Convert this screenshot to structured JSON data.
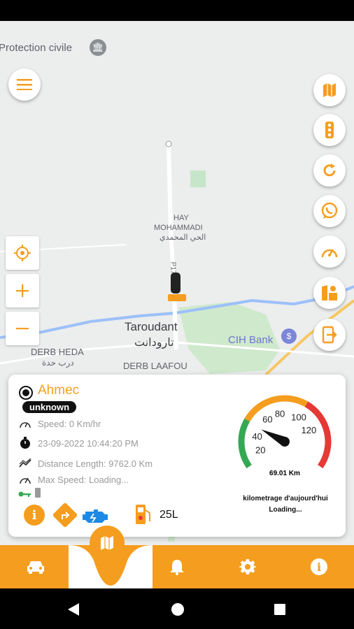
{
  "map": {
    "poi_protection": "Protection civile",
    "hay_line1": "HAY",
    "hay_line2": "MOHAMMADI",
    "hay_arabic": "الحي المحمدي",
    "road_label": "P17",
    "city_name": "Taroudant",
    "city_arabic": "تارودانت",
    "bank": "CIH Bank",
    "derb_heda": "DERB HEDA",
    "derb_heda_ar": "درب حدة",
    "derb_laafou": "DERB LAAFOU"
  },
  "vehicle": {
    "name": "Ahmec",
    "status": "unknown",
    "speed": "Speed: 0 Km/hr",
    "datetime": "23-09-2022 10:44:20 PM",
    "distance": "Distance Length: 9762.0 Km",
    "max_speed": "Max Speed: Loading...",
    "fuel": "25L"
  },
  "gauge": {
    "ticks": [
      "20",
      "40",
      "60",
      "80",
      "100",
      "120"
    ],
    "value_label": "69.01 Km",
    "caption_line1": "kilometrage d'aujourd'hui",
    "caption_line2": "Loading...",
    "needle_fraction": 0.25
  },
  "colors": {
    "accent": "#f59d1f",
    "green": "#35a853",
    "red": "#e53935"
  }
}
